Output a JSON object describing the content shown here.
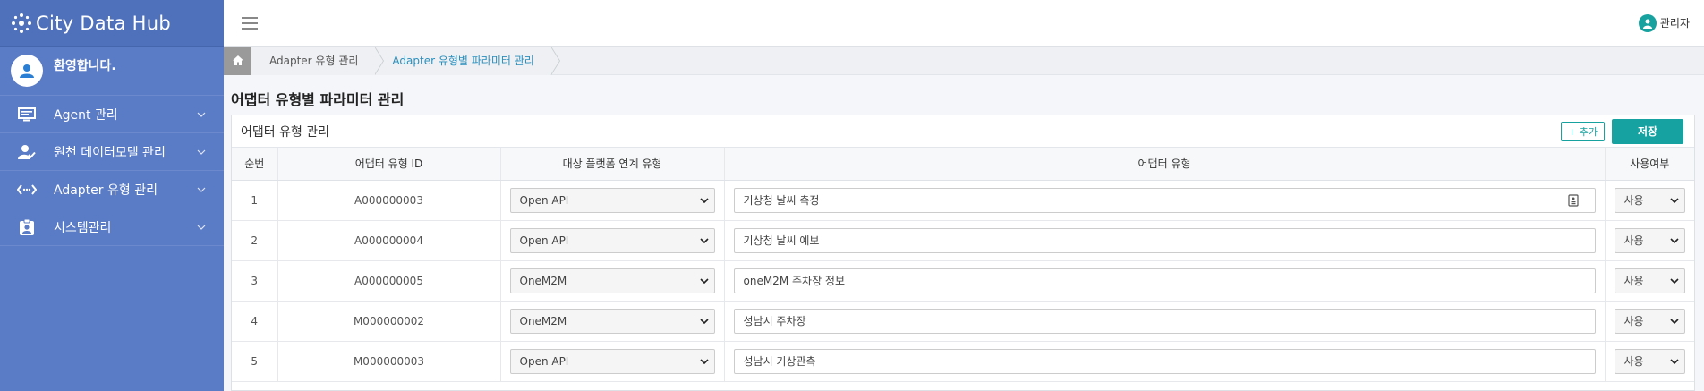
{
  "app": {
    "title": "City Data Hub"
  },
  "user_panel": {
    "welcome": "환영합니다."
  },
  "sidebar": {
    "items": [
      {
        "label": "Agent 관리",
        "icon": "monitor-icon"
      },
      {
        "label": "원천 데이터모델 관리",
        "icon": "user-check-icon"
      },
      {
        "label": "Adapter 유형 관리",
        "icon": "code-arrows-icon"
      },
      {
        "label": "시스템관리",
        "icon": "clipboard-user-icon"
      }
    ]
  },
  "header": {
    "admin_label": "관리자"
  },
  "breadcrumb": {
    "items": [
      {
        "label": "Adapter 유형 관리"
      },
      {
        "label": "Adapter 유형별 파라미터 관리"
      }
    ]
  },
  "page": {
    "title": "어댑터 유형별 파라미터 관리"
  },
  "card": {
    "title": "어댑터 유형 관리",
    "add_label": "+ 추가",
    "save_label": "저장"
  },
  "table": {
    "headers": [
      "순번",
      "어댑터 유형 ID",
      "대상 플랫폼 연계 유형",
      "어댑터 유형",
      "사용여부"
    ],
    "rows": [
      {
        "num": "1",
        "id": "A000000003",
        "platform": "Open API",
        "type": "기상청 날씨 측정",
        "use": "사용"
      },
      {
        "num": "2",
        "id": "A000000004",
        "platform": "Open API",
        "type": "기상청 날씨 예보",
        "use": "사용"
      },
      {
        "num": "3",
        "id": "A000000005",
        "platform": "OneM2M",
        "type": "oneM2M 주차장 정보",
        "use": "사용"
      },
      {
        "num": "4",
        "id": "M000000002",
        "platform": "OneM2M",
        "type": "성남시 주차장",
        "use": "사용"
      },
      {
        "num": "5",
        "id": "M000000003",
        "platform": "Open API",
        "type": "성남시 기상관측",
        "use": "사용"
      }
    ]
  },
  "colors": {
    "sidebar": "#5a7bc5",
    "accent": "#17a2a0",
    "breadcrumb_active": "#2a8fbd"
  }
}
